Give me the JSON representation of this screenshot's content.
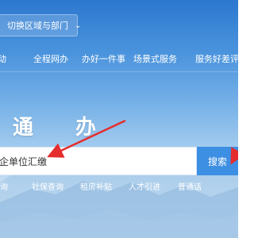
{
  "header": {
    "region_label": "切换区域与部门",
    "chevron_icon": "chevron-down-icon"
  },
  "nav": {
    "items": [
      "互动",
      "全程网办",
      "办好一件事",
      "场景式服务",
      "服务好差评"
    ]
  },
  "hero": {
    "title": "通 办"
  },
  "search": {
    "value": "企单位汇缴",
    "button_label": "搜索"
  },
  "quick_links": [
    "查询",
    "社保查询",
    "租房补贴",
    "人才引进",
    "普通话"
  ],
  "colors": {
    "accent": "#3d8fe3",
    "arrow": "#e52d2d",
    "header_blue": "#2c78cf"
  }
}
